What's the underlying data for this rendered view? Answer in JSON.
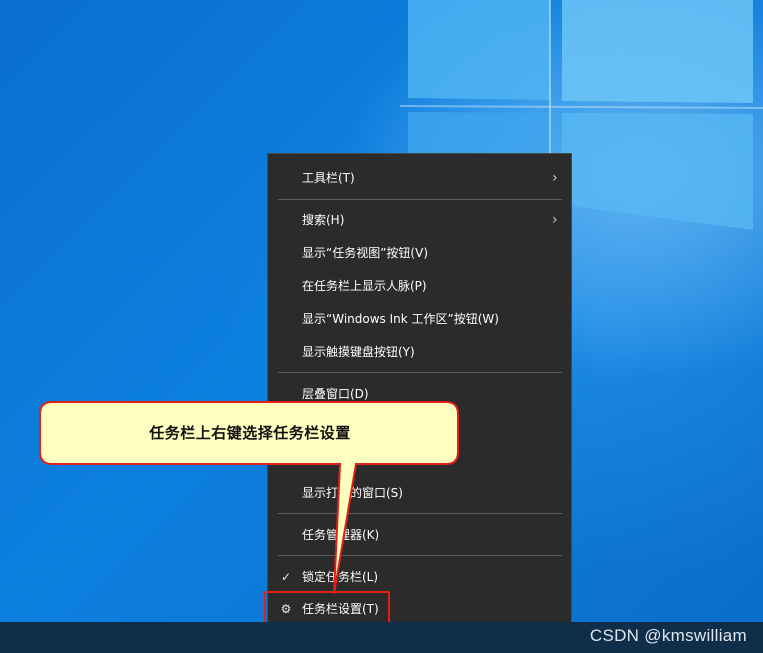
{
  "menu": {
    "items": [
      {
        "label": "工具栏(T)",
        "submenu": true
      },
      {
        "label": "搜索(H)",
        "submenu": true
      },
      {
        "label": "显示“任务视图”按钮(V)"
      },
      {
        "label": "在任务栏上显示人脉(P)"
      },
      {
        "label": "显示“Windows Ink 工作区”按钮(W)"
      },
      {
        "label": "显示触摸键盘按钮(Y)"
      },
      {
        "label": "层叠窗口(D)"
      },
      {
        "label": "显示打开的窗口(S)"
      },
      {
        "label": "任务管理器(K)"
      },
      {
        "label": "锁定任务栏(L)",
        "checked": true,
        "check_glyph": "✓"
      },
      {
        "label": "任务栏设置(T)",
        "icon": "gear-icon",
        "icon_glyph": "⚙"
      }
    ],
    "chevron": "›"
  },
  "annotation": {
    "callout_text": "任务栏上右键选择任务栏设置",
    "callout_fill": "#ffffc0",
    "border_color": "#e0201a"
  },
  "watermark": "CSDN @kmswilliam",
  "colors": {
    "desktop_blue": "#0a78d7",
    "menu_bg": "#2b2b2b",
    "taskbar": "#0f2e4a"
  }
}
